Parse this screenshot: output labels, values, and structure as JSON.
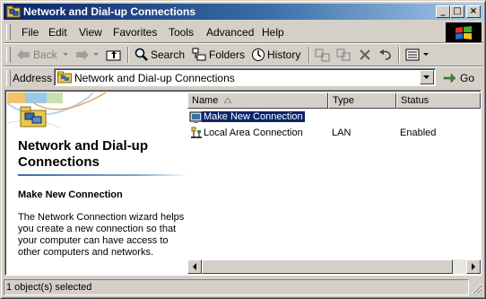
{
  "window": {
    "title": "Network and Dial-up Connections",
    "controls": {
      "minimize": "_",
      "maximize": "□",
      "close": "×"
    }
  },
  "menu": [
    "File",
    "Edit",
    "View",
    "Favorites",
    "Tools",
    "Advanced",
    "Help"
  ],
  "toolbar": {
    "back": "Back",
    "search": "Search",
    "folders": "Folders",
    "history": "History"
  },
  "address": {
    "label": "Address",
    "value": "Network and Dial-up Connections",
    "go": "Go"
  },
  "left_pane": {
    "title": "Network and Dial-up Connections",
    "selected_item": "Make New Connection",
    "description": "The Network Connection wizard helps you create a new connection so that your computer can have access to other computers and networks."
  },
  "list": {
    "columns": [
      "Name",
      "Type",
      "Status"
    ],
    "rows": [
      {
        "name": "Make New Connection",
        "type": "",
        "status": "",
        "icon": "new-connection-icon",
        "selected": true
      },
      {
        "name": "Local Area Connection",
        "type": "LAN",
        "status": "Enabled",
        "icon": "lan-connection-icon",
        "selected": false
      }
    ]
  },
  "status_bar": {
    "text": "1 object(s) selected"
  },
  "colors": {
    "titlebar_start": "#0a246a",
    "titlebar_end": "#a6caf0",
    "selection": "#0a246a",
    "face": "#d4d0c8"
  }
}
